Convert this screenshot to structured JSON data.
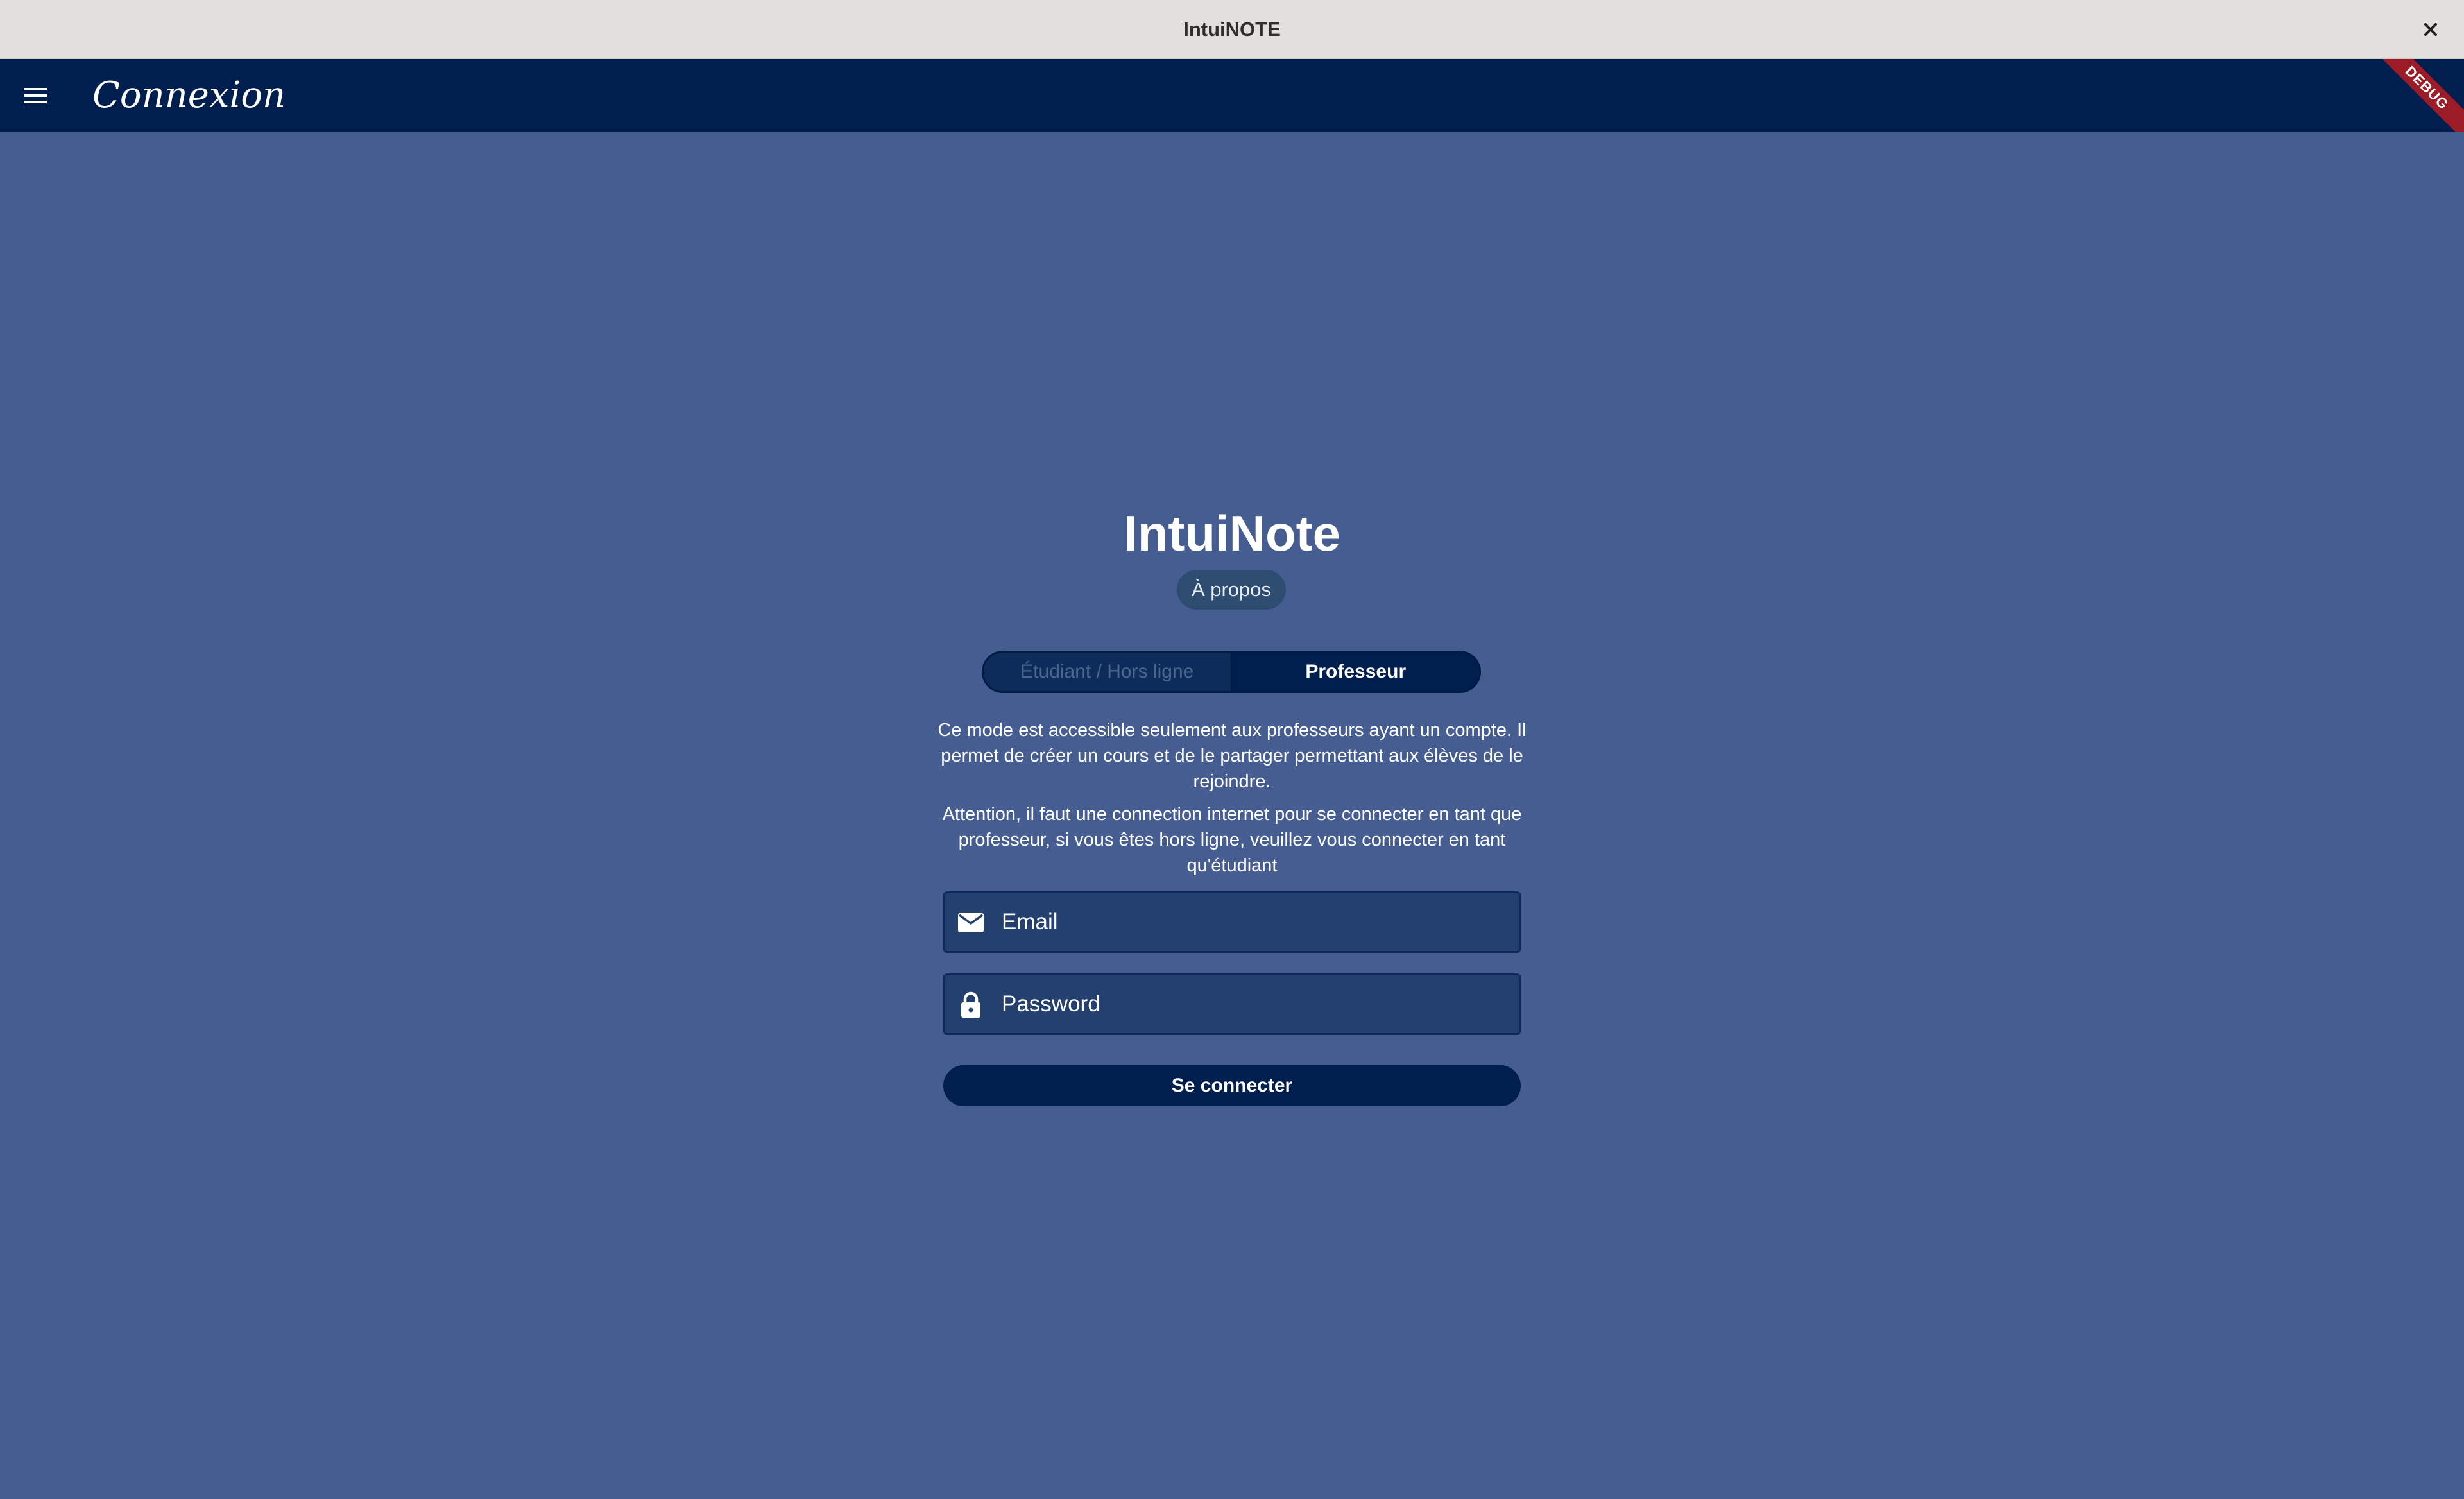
{
  "window": {
    "title": "IntuiNOTE",
    "close_icon": "close-icon"
  },
  "app_bar": {
    "menu_icon": "menu-icon",
    "title": "Connexion",
    "debug_banner": "DEBUG",
    "background": "#001e4e"
  },
  "login": {
    "app_name": "IntuiNote",
    "about_label": "À propos",
    "mode_toggle": {
      "options": [
        "Étudiant / Hors ligne",
        "Professeur"
      ],
      "selected": "Professeur"
    },
    "description_1": "Ce mode est accessible seulement aux professeurs ayant un compte. Il permet de créer un cours et de le partager permettant aux élèves de le rejoindre.",
    "description_2": "Attention, il faut une connection internet pour se connecter en tant que professeur, si vous êtes hors ligne, veuillez vous connecter en tant qu'étudiant",
    "email": {
      "icon": "mail-icon",
      "placeholder": "Email",
      "value": ""
    },
    "password": {
      "icon": "lock-icon",
      "placeholder": "Password",
      "value": ""
    },
    "connect_label": "Se connecter"
  },
  "colors": {
    "page_background": "#465d92",
    "accent": "#001e4e",
    "titlebar": "#e2dfdc",
    "debug_red": "#9b1b26"
  }
}
